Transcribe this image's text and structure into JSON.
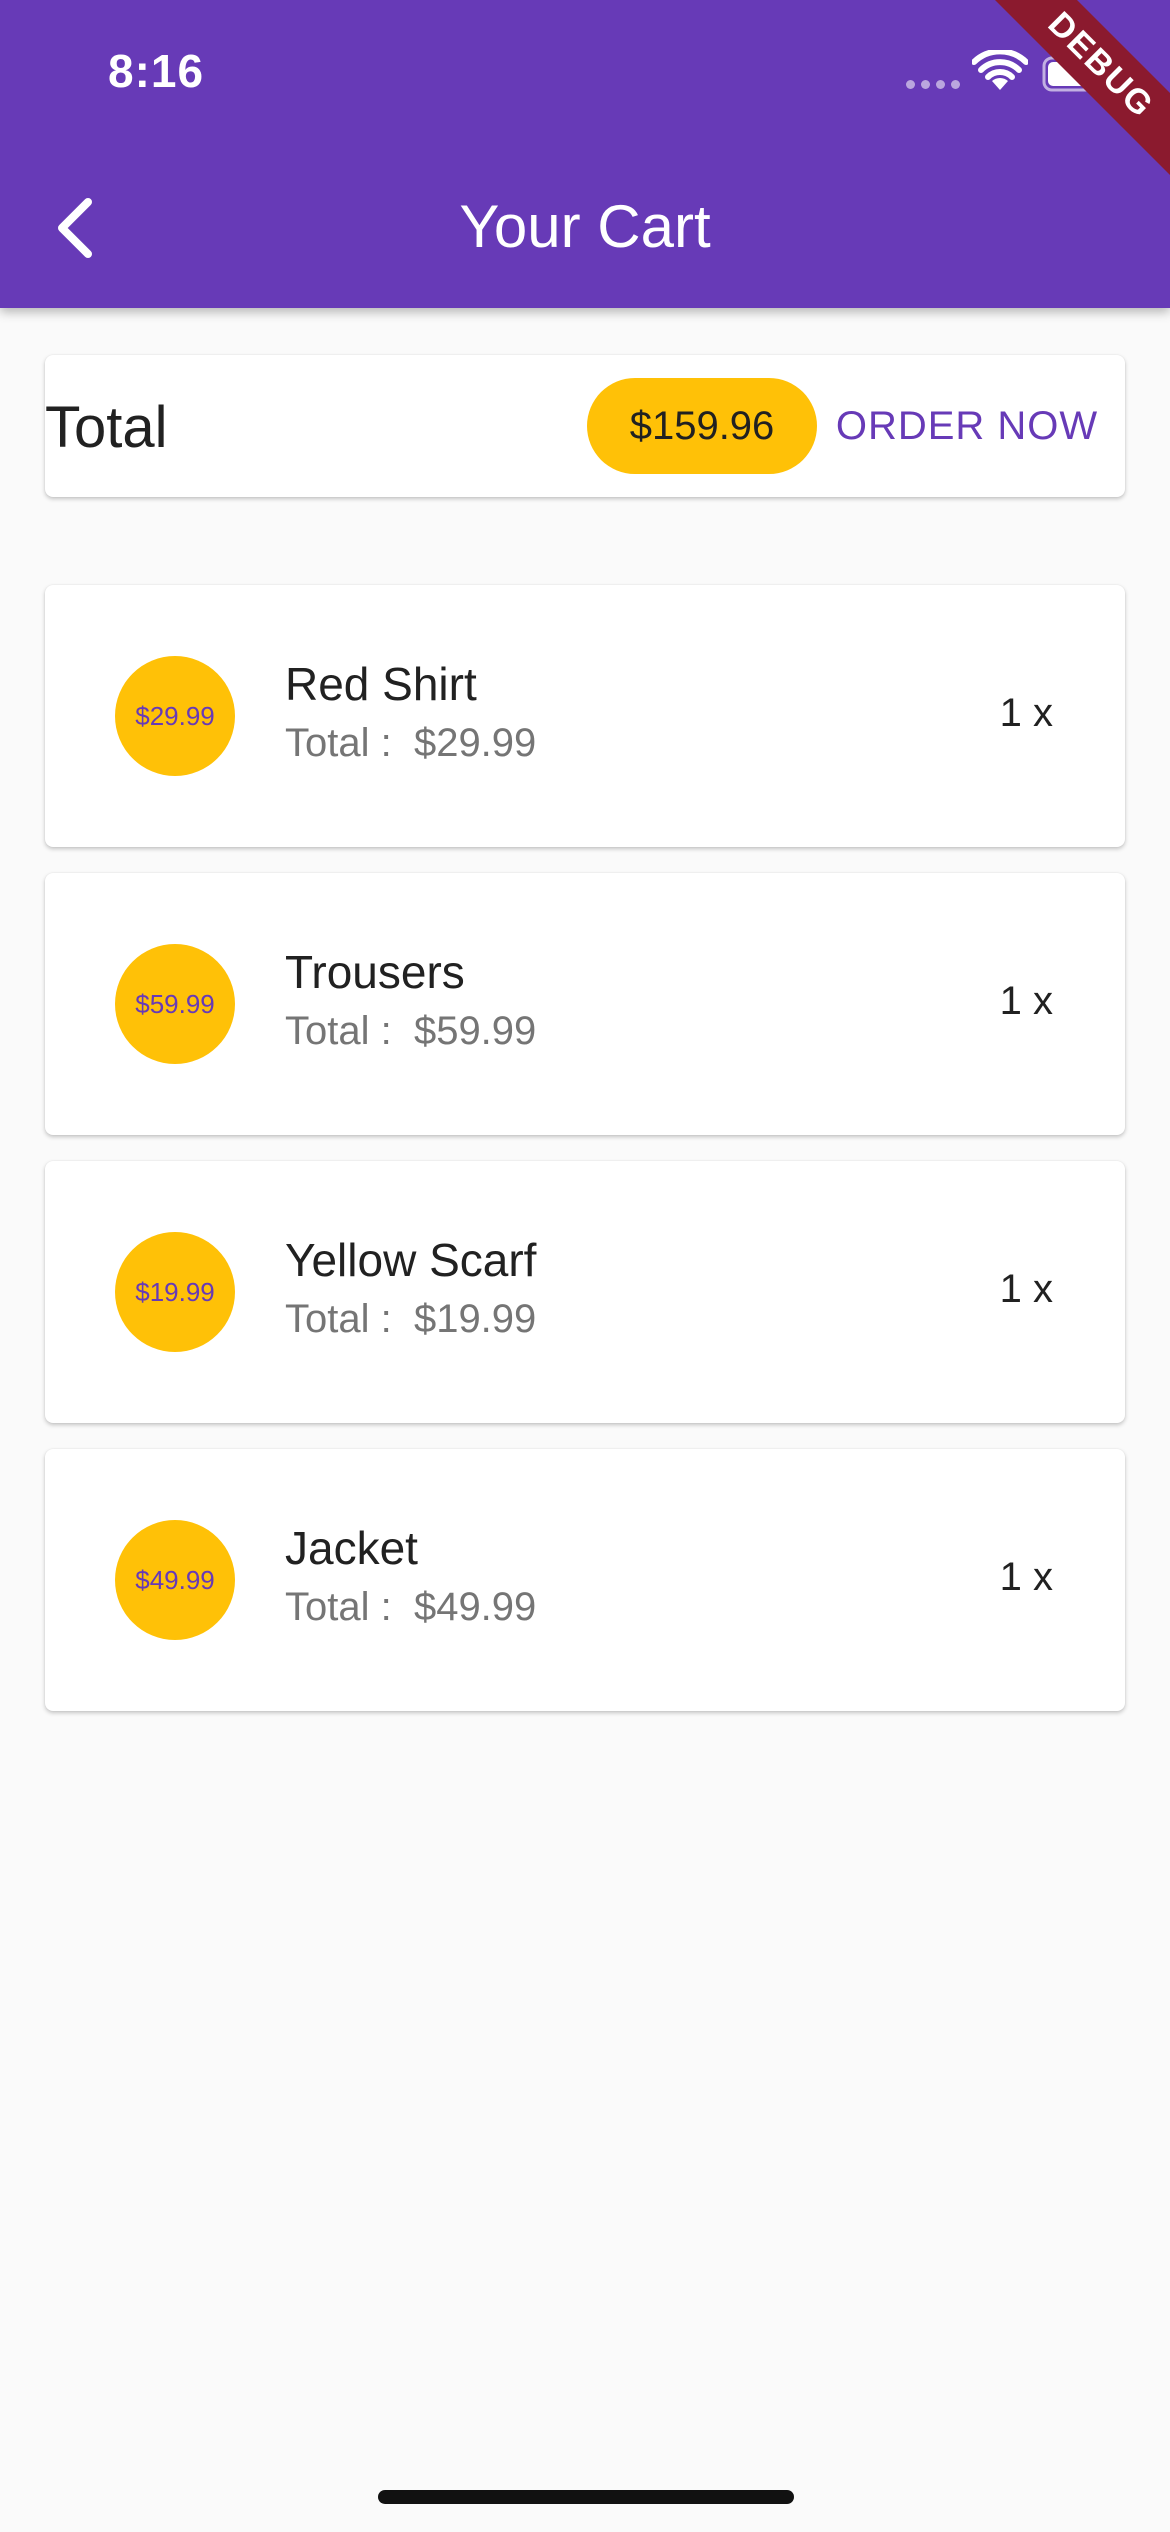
{
  "status_bar": {
    "time": "8:16"
  },
  "debug_banner": "DEBUG",
  "app_bar": {
    "title": "Your Cart",
    "back_icon": "chevron-left-icon"
  },
  "summary": {
    "label": "Total",
    "amount": "$159.96",
    "order_button": "ORDER NOW"
  },
  "cart_items": [
    {
      "avatar": "$29.99",
      "title": "Red Shirt",
      "subtitle": "Total :  $29.99",
      "quantity": "1 x"
    },
    {
      "avatar": "$59.99",
      "title": "Trousers",
      "subtitle": "Total :  $59.99",
      "quantity": "1 x"
    },
    {
      "avatar": "$19.99",
      "title": "Yellow Scarf",
      "subtitle": "Total :  $19.99",
      "quantity": "1 x"
    },
    {
      "avatar": "$49.99",
      "title": "Jacket",
      "subtitle": "Total :  $49.99",
      "quantity": "1 x"
    }
  ],
  "colors": {
    "primary": "#673ab7",
    "accent": "#ffc107",
    "background": "#fafafa"
  }
}
